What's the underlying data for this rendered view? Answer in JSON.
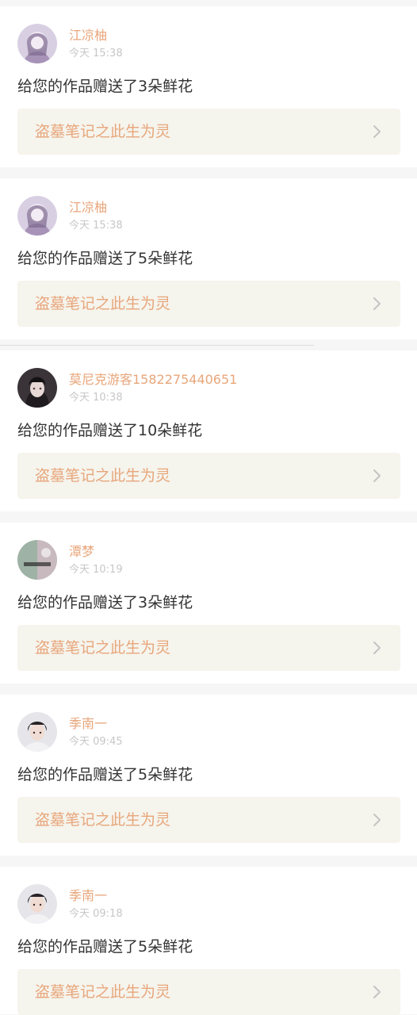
{
  "notifications": [
    {
      "user": "江凉柚",
      "time": "今天 15:38",
      "message": "给您的作品赠送了3朵鲜花",
      "work_title": "盗墓笔记之此生为灵",
      "avatar_icon": "avatar-anime-girl-icon"
    },
    {
      "user": "江凉柚",
      "time": "今天 15:38",
      "message": "给您的作品赠送了5朵鲜花",
      "work_title": "盗墓笔记之此生为灵",
      "avatar_icon": "avatar-anime-girl-icon"
    },
    {
      "user": "莫尼克游客1582275440651",
      "time": "今天 10:38",
      "message": "给您的作品赠送了10朵鲜花",
      "work_title": "盗墓笔记之此生为灵",
      "avatar_icon": "avatar-dark-hair-girl-icon"
    },
    {
      "user": "潭梦",
      "time": "今天 10:19",
      "message": "给您的作品赠送了3朵鲜花",
      "work_title": "盗墓笔记之此生为灵",
      "avatar_icon": "avatar-scenery-icon"
    },
    {
      "user": "季南一",
      "time": "今天 09:45",
      "message": "给您的作品赠送了5朵鲜花",
      "work_title": "盗墓笔记之此生为灵",
      "avatar_icon": "avatar-portrait-icon"
    },
    {
      "user": "季南一",
      "time": "今天 09:18",
      "message": "给您的作品赠送了5朵鲜花",
      "work_title": "盗墓笔记之此生为灵",
      "avatar_icon": "avatar-portrait-icon"
    }
  ],
  "colors": {
    "accent": "#e8a67b",
    "time": "#c7c7c7",
    "text": "#333333",
    "link_bg": "#f5f4ed",
    "page_bg": "#f6f6f6"
  }
}
